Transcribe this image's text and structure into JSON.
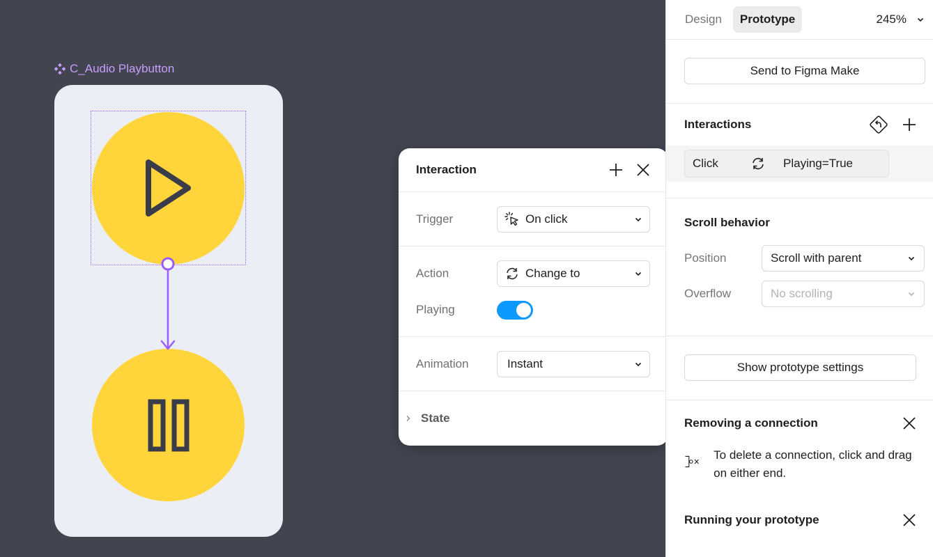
{
  "canvas": {
    "frame_label": "C_Audio Playbutton"
  },
  "popover": {
    "title": "Interaction",
    "trigger_label": "Trigger",
    "trigger_value": "On click",
    "action_label": "Action",
    "action_value": "Change to",
    "playing_label": "Playing",
    "playing_on": true,
    "animation_label": "Animation",
    "animation_value": "Instant",
    "state_label": "State"
  },
  "panel": {
    "tabs": [
      "Design",
      "Prototype"
    ],
    "active_tab": "Prototype",
    "zoom": "245%",
    "send_button": "Send to Figma Make",
    "interactions_title": "Interactions",
    "interaction": {
      "trigger": "Click",
      "result": "Playing=True"
    },
    "scroll_title": "Scroll behavior",
    "position_label": "Position",
    "position_value": "Scroll with parent",
    "overflow_label": "Overflow",
    "overflow_value": "No scrolling",
    "show_settings_button": "Show prototype settings",
    "tip1_title": "Removing a connection",
    "tip1_text": "To delete a connection, click and drag on either end.",
    "tip2_title": "Running your prototype"
  },
  "colors": {
    "canvas_bg": "#424550",
    "accent_purple": "#9b5cff",
    "button_yellow": "#ffd53b",
    "toggle_blue": "#0d99ff"
  }
}
